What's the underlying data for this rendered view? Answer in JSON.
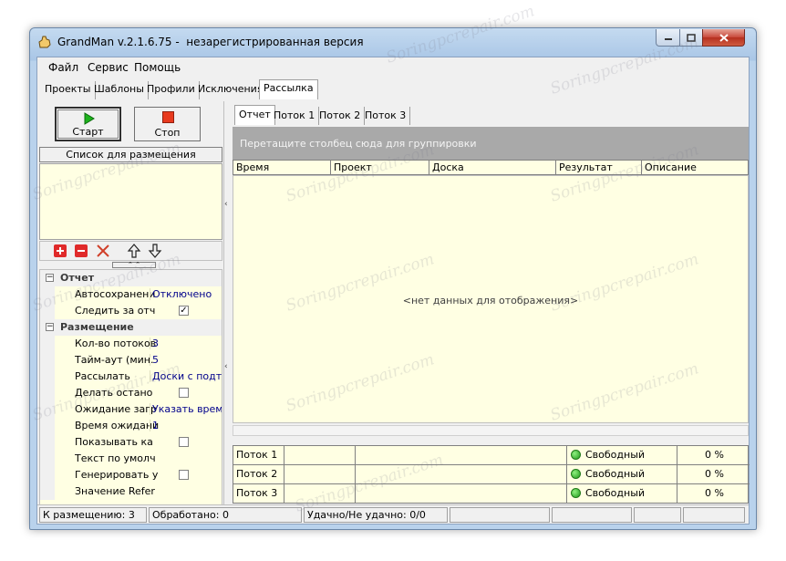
{
  "window": {
    "title": "GrandMan v.2.1.6.75 -  незарегистрированная версия"
  },
  "menu": [
    "Файл",
    "Сервис",
    "Помощь"
  ],
  "main_tabs": [
    {
      "label": "Проекты"
    },
    {
      "label": "Шаблоны"
    },
    {
      "label": "Профили"
    },
    {
      "label": "Исключения"
    },
    {
      "label": "Рассылка",
      "active": true
    }
  ],
  "toolbar": {
    "start_label": "Старт",
    "stop_label": "Стоп"
  },
  "placement_list": {
    "header": "Список для размещения"
  },
  "icons": [
    "add-icon",
    "remove-icon",
    "clear-icon",
    "move-up-icon",
    "move-down-icon"
  ],
  "properties": [
    {
      "type": "category",
      "name": "Отчет"
    },
    {
      "name": "Автосохранени",
      "value": "Отключено"
    },
    {
      "name": "Следить за отч",
      "check": true
    },
    {
      "type": "category",
      "name": "Размещение"
    },
    {
      "name": "Кол-во потоков",
      "value": "3"
    },
    {
      "name": "Тайм-аут (мин.",
      "value": "5"
    },
    {
      "name": "Рассылать",
      "value": "Доски с подтве"
    },
    {
      "name": "Делать остано",
      "check": false
    },
    {
      "name": "Ожидание загр",
      "value": "Указать время"
    },
    {
      "name": "Время ожидани",
      "value": "1"
    },
    {
      "name": "Показывать ка",
      "check": false
    },
    {
      "name": "Текст по умолч",
      "value": ""
    },
    {
      "name": "Генерировать у",
      "check": false
    },
    {
      "name": "Значение Refer",
      "value": ""
    }
  ],
  "sub_tabs": [
    {
      "label": "Отчет",
      "active": true
    },
    {
      "label": "Поток 1"
    },
    {
      "label": "Поток 2"
    },
    {
      "label": "Поток 3"
    }
  ],
  "grid": {
    "group_hint": "Перетащите столбец сюда для группировки",
    "columns": [
      "Время",
      "Проект",
      "Доска",
      "Результат",
      "Описание"
    ],
    "empty_text": "<нет данных для отображения>"
  },
  "threads": [
    {
      "name": "Поток 1",
      "status": "Свободный",
      "progress": "0 %"
    },
    {
      "name": "Поток 2",
      "status": "Свободный",
      "progress": "0 %"
    },
    {
      "name": "Поток 3",
      "status": "Свободный",
      "progress": "0 %"
    }
  ],
  "status": {
    "to_place": "К размещению: 3",
    "processed": "Обработано: 0",
    "success": "Удачно/Не удачно: 0/0"
  },
  "watermark": "Soringpcrepair.com",
  "colors": {
    "grid_bg": "#ffffe3",
    "group_area": "#a9a9a9",
    "status_ok": "#2fbf2a"
  }
}
